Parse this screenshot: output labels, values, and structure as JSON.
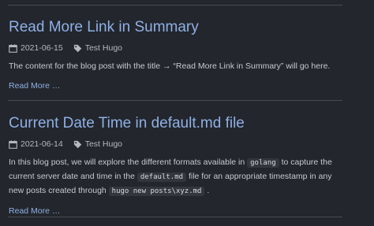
{
  "posts": [
    {
      "title": "Read More Link in Summary",
      "date": "2021-06-15",
      "tag": "Test Hugo",
      "summary": {
        "parts": [
          {
            "text": "The content for the blog post with the title → “Read More Link in Summary” will go here.",
            "code": false
          }
        ]
      },
      "read_more": "Read More …"
    },
    {
      "title": "Current Date Time in default.md file",
      "date": "2021-06-14",
      "tag": "Test Hugo",
      "summary": {
        "parts": [
          {
            "text": "In this blog post, we will explore the different formats available in ",
            "code": false
          },
          {
            "text": "golang",
            "code": true
          },
          {
            "text": " to capture the current server date and time in the ",
            "code": false
          },
          {
            "text": "default.md",
            "code": true
          },
          {
            "text": " file for an appropriate timestamp in any new posts created through ",
            "code": false
          },
          {
            "text": "hugo new posts\\xyz.md",
            "code": true
          },
          {
            "text": " .",
            "code": false
          }
        ]
      },
      "read_more": "Read More …"
    }
  ],
  "icons": {
    "date": "calendar-icon",
    "tag": "tag-icon"
  },
  "colors": {
    "background": "#23262c",
    "text": "#c6cad1",
    "link": "#8fb0e6",
    "rule": "#474b53",
    "code_bg": "#33363d"
  }
}
